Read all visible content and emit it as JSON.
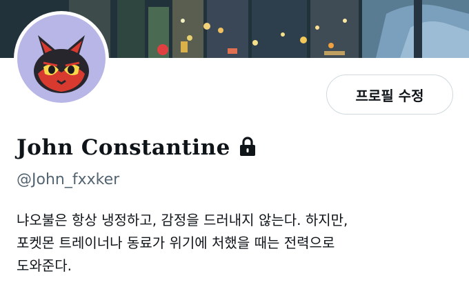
{
  "profile": {
    "display_name": "John Constantine",
    "handle": "@John_fxxker",
    "bio_lines": [
      "냐오불은 항상 냉정하고, 감정을 드러내지 않는다. 하지만,",
      "포켓몬 트레이너나 동료가 위기에 처했을 때는 전력으로",
      "도와준다."
    ],
    "protected": true
  },
  "actions": {
    "edit_profile_label": "프로필 수정"
  },
  "colors": {
    "primary_text": "#0f1419",
    "secondary_text": "#536471",
    "button_border": "#cfd9de",
    "avatar_bg": "#b8b6e6"
  },
  "icons": {
    "lock": "lock-icon",
    "avatar": "cat-avatar"
  }
}
